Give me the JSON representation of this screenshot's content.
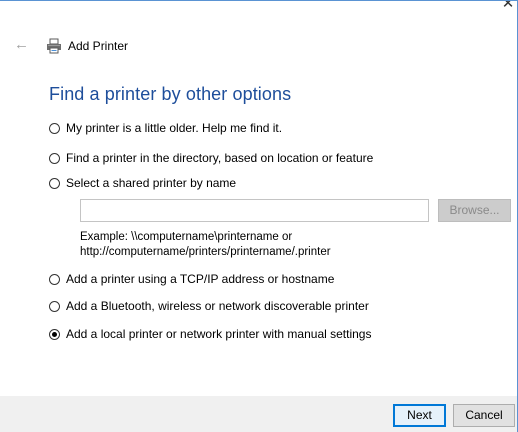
{
  "window": {
    "title": "Add Printer",
    "close_glyph": "✕",
    "back_glyph": "←"
  },
  "page": {
    "heading": "Find a printer by other options"
  },
  "options": [
    {
      "label": "My printer is a little older. Help me find it.",
      "checked": false
    },
    {
      "label": "Find a printer in the directory, based on location or feature",
      "checked": false
    },
    {
      "label": "Select a shared printer by name",
      "checked": false
    },
    {
      "label": "Add a printer using a TCP/IP address or hostname",
      "checked": false
    },
    {
      "label": "Add a Bluetooth, wireless or network discoverable printer",
      "checked": false
    },
    {
      "label": "Add a local printer or network printer with manual settings",
      "checked": true
    }
  ],
  "shared_printer": {
    "value": "",
    "browse_label": "Browse...",
    "example_line1": "Example: \\\\computername\\printername or",
    "example_line2": "http://computername/printers/printername/.printer"
  },
  "footer": {
    "next_label": "Next",
    "cancel_label": "Cancel"
  },
  "icons": {
    "title_icon": "printer-icon",
    "back_icon": "back-arrow-icon",
    "close_icon": "close-icon"
  },
  "colors": {
    "heading": "#1e4e9b",
    "window_border": "#5a93d3",
    "footer_bg": "#f0f0f0",
    "default_button_border": "#0078d7"
  }
}
